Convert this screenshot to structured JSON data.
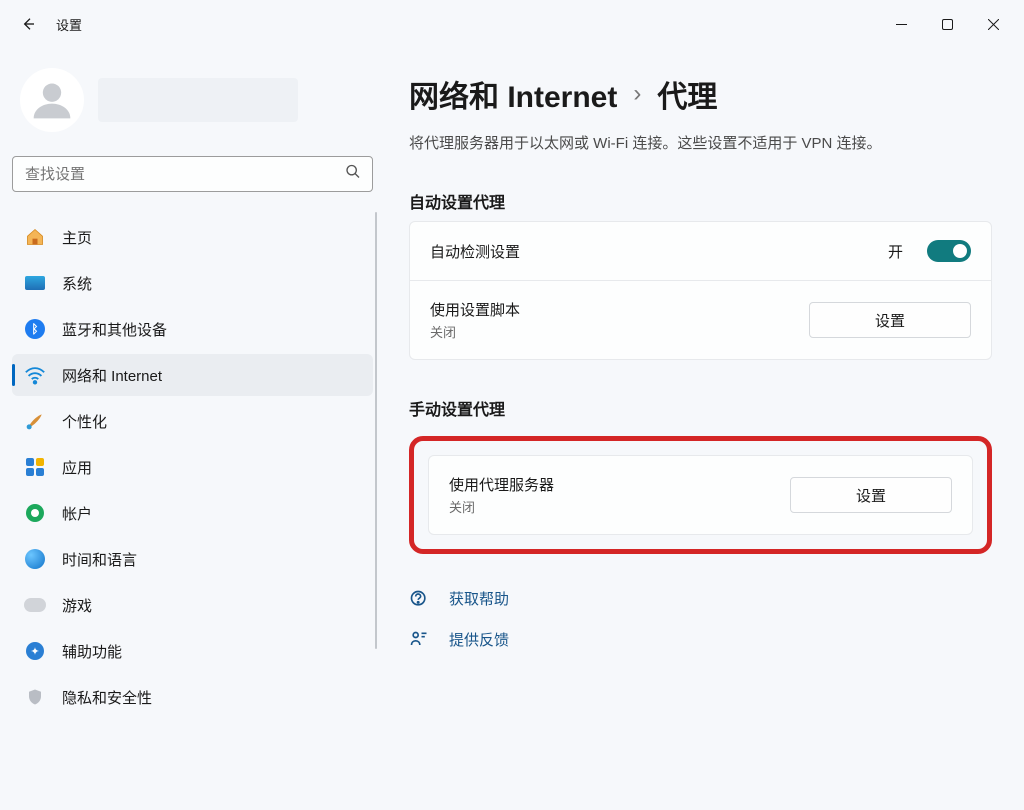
{
  "app": {
    "title": "设置"
  },
  "search": {
    "placeholder": "查找设置"
  },
  "sidebar": {
    "items": [
      {
        "label": "主页"
      },
      {
        "label": "系统"
      },
      {
        "label": "蓝牙和其他设备"
      },
      {
        "label": "网络和 Internet"
      },
      {
        "label": "个性化"
      },
      {
        "label": "应用"
      },
      {
        "label": "帐户"
      },
      {
        "label": "时间和语言"
      },
      {
        "label": "游戏"
      },
      {
        "label": "辅助功能"
      },
      {
        "label": "隐私和安全性"
      }
    ]
  },
  "breadcrumb": {
    "parent": "网络和 Internet",
    "current": "代理"
  },
  "subtitle": "将代理服务器用于以太网或 Wi-Fi 连接。这些设置不适用于 VPN 连接。",
  "sections": {
    "auto": {
      "title": "自动设置代理",
      "detect": {
        "label": "自动检测设置",
        "state": "开",
        "on": true
      },
      "script": {
        "label": "使用设置脚本",
        "status": "关闭",
        "button": "设置"
      }
    },
    "manual": {
      "title": "手动设置代理",
      "proxy": {
        "label": "使用代理服务器",
        "status": "关闭",
        "button": "设置"
      }
    }
  },
  "footer": {
    "help": "获取帮助",
    "feedback": "提供反馈"
  }
}
